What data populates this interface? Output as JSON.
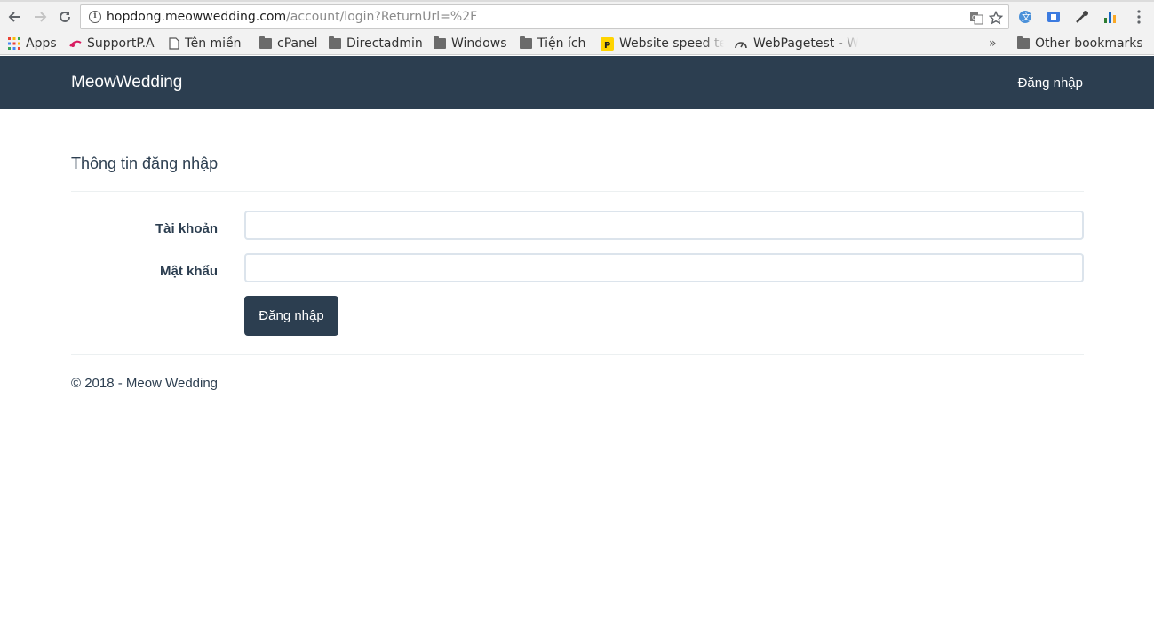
{
  "browser": {
    "url_host": "hopdong.meowwedding.com",
    "url_path": "/account/login?ReturnUrl=%2F",
    "bookmarks": [
      {
        "label": "Apps",
        "icon": "apps-grid-icon"
      },
      {
        "label": "SupportP.A",
        "icon": "pa-logo-icon"
      },
      {
        "label": "Tên miền",
        "icon": "page-icon"
      },
      {
        "label": "cPanel",
        "icon": "folder-icon"
      },
      {
        "label": "Directadmin",
        "icon": "folder-icon"
      },
      {
        "label": "Windows",
        "icon": "folder-icon"
      },
      {
        "label": "Tiện ích",
        "icon": "folder-icon"
      },
      {
        "label": "Website speed te",
        "icon": "pingdom-icon"
      },
      {
        "label": "WebPagetest - W",
        "icon": "speedometer-icon"
      }
    ],
    "overflow_label": "»",
    "other_bookmarks": "Other bookmarks"
  },
  "navbar": {
    "brand": "MeowWedding",
    "login_link": "Đăng nhập",
    "bg_color": "#2c3e50"
  },
  "login": {
    "title": "Thông tin đăng nhập",
    "username_label": "Tài khoản",
    "username_value": "",
    "password_label": "Mật khẩu",
    "password_value": "",
    "submit_label": "Đăng nhập"
  },
  "footer": {
    "text": "© 2018 - Meow Wedding"
  }
}
